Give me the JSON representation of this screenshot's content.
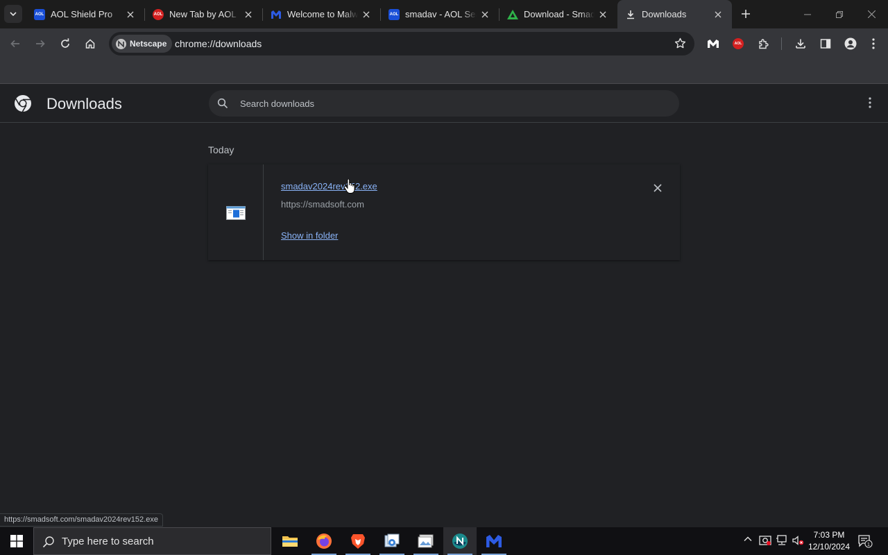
{
  "tabs": [
    {
      "title": "AOL Shield Pro",
      "favicon": "aol-icon",
      "active": false
    },
    {
      "title": "New Tab by AOL",
      "favicon": "aol-red-icon",
      "active": false
    },
    {
      "title": "Welcome to Malwarebytes",
      "favicon": "malwarebytes-icon",
      "active": false
    },
    {
      "title": "smadav - AOL Search",
      "favicon": "aol-icon",
      "active": false
    },
    {
      "title": "Download - Smadav",
      "favicon": "smadav-icon",
      "active": false
    },
    {
      "title": "Downloads",
      "favicon": "download-icon",
      "active": true
    }
  ],
  "toolbar": {
    "site_chip": "Netscape",
    "url": "chrome://downloads"
  },
  "downloads_page": {
    "title": "Downloads",
    "search_placeholder": "Search downloads",
    "date_group": "Today",
    "item": {
      "filename": "smadav2024rev152.exe",
      "origin": "https://smadsoft.com",
      "action": "Show in folder"
    }
  },
  "status_bar": "https://smadsoft.com/smadav2024rev152.exe",
  "taskbar": {
    "search_placeholder": "Type here to search",
    "time": "7:03 PM",
    "date": "12/10/2024",
    "notification_count": "1"
  },
  "colors": {
    "accent_link": "#8ab4f8",
    "page_bg": "#202124",
    "toolbar_bg": "#35363a"
  }
}
